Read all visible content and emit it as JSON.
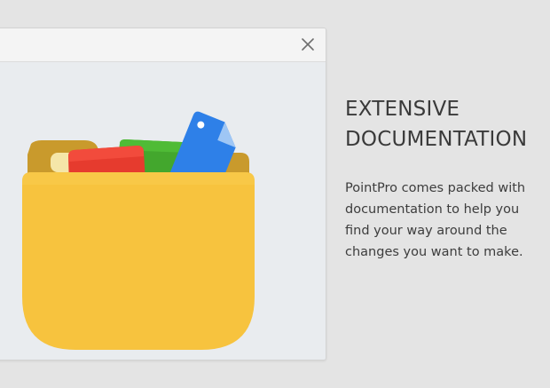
{
  "dialog": {
    "close_icon": "close-icon"
  },
  "illustration": {
    "icon": "folder-documents-icon",
    "colors": {
      "folder": "#f7c33e",
      "folder_back": "#c99a2c",
      "red_document": "#e63b2e",
      "green_document": "#43a72d",
      "blue_tag": "#2e80e8",
      "light_document": "#f5e6a8"
    }
  },
  "feature": {
    "title": "EXTENSIVE DOCUMENTATION",
    "description": "PointPro comes packed with documentation to help you find your way around the changes you want to make."
  }
}
